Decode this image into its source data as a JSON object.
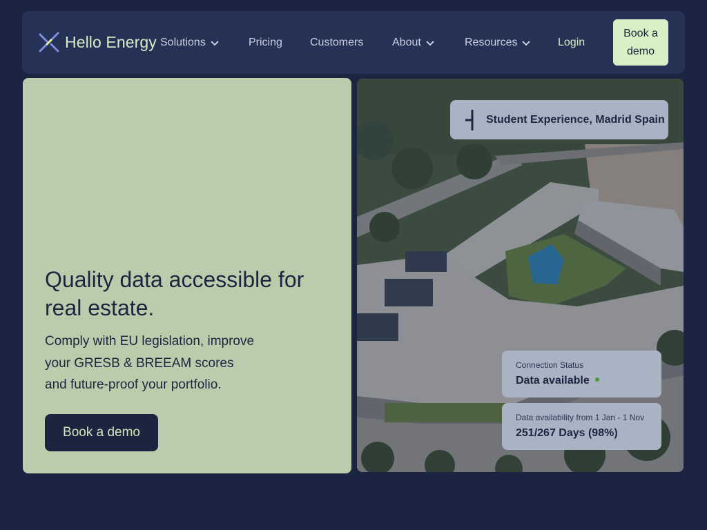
{
  "brand": {
    "name": "Hello Energy",
    "logo_icon": "hello-energy-logo-icon"
  },
  "nav": {
    "items": [
      {
        "label": "Solutions",
        "has_dropdown": true
      },
      {
        "label": "Pricing",
        "has_dropdown": false
      },
      {
        "label": "Customers",
        "has_dropdown": false
      },
      {
        "label": "About",
        "has_dropdown": true
      },
      {
        "label": "Resources",
        "has_dropdown": true
      }
    ],
    "login": "Login",
    "cta": "Book a demo"
  },
  "hero": {
    "title": "Quality data accessible for real estate.",
    "subtitle_lines": [
      "Comply with EU legislation, improve",
      "your GRESB & BREEAM scores",
      "and future-proof your portfolio."
    ],
    "button": "Book a demo"
  },
  "showcase": {
    "location": "Student Experience, Madrid Spain",
    "connection": {
      "label": "Connection Status",
      "value": "Data available"
    },
    "availability": {
      "label": "Data availability from 1 Jan - 1 Nov",
      "value": "251/267 Days (98%)"
    }
  },
  "colors": {
    "background": "#1b2440",
    "navbar": "#263156",
    "hero_card": "#b9cdad",
    "cta": "#d8f0c6",
    "accent_text": "#d6ecc5",
    "status_ok": "#4a9a3a"
  }
}
